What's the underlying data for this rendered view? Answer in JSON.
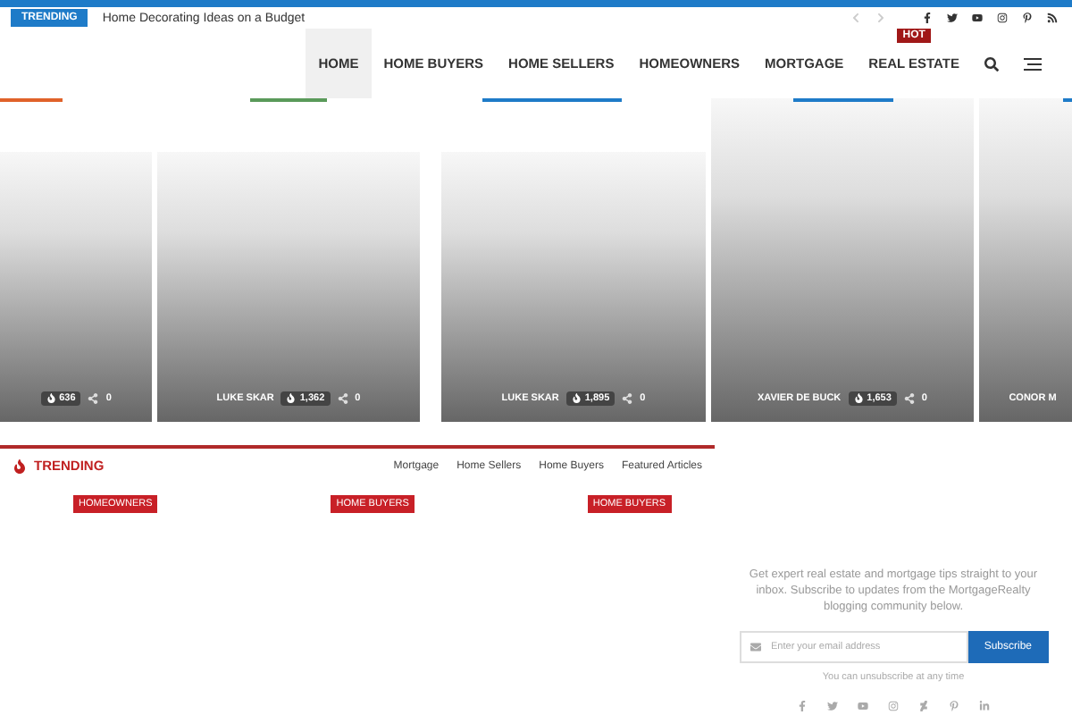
{
  "topbar": {
    "badge": "TRENDING",
    "headline": "Home Decorating Ideas on a Budget"
  },
  "nav": {
    "items": [
      {
        "label": "HOME",
        "selected": true
      },
      {
        "label": "HOME BUYERS",
        "selected": false
      },
      {
        "label": "HOME SELLERS",
        "selected": false
      },
      {
        "label": "HOMEOWNERS",
        "selected": false
      },
      {
        "label": "MORTGAGE",
        "selected": false
      },
      {
        "label": "REAL ESTATE",
        "selected": false,
        "badge": "HOT"
      }
    ]
  },
  "cards": [
    {
      "color": "#e0622a",
      "views": "636",
      "shares": "0"
    },
    {
      "color": "#5a9a5a",
      "author": "LUKE SKAR",
      "views": "1,362",
      "shares": "0"
    },
    {
      "color": "#1e7bc8",
      "author": "LUKE SKAR",
      "views": "1,895",
      "shares": "0"
    },
    {
      "color": "#1e7bc8",
      "author": "XAVIER DE BUCK",
      "views": "1,653",
      "shares": "0"
    },
    {
      "color": "#1e7bc8",
      "author": "CONOR M"
    }
  ],
  "trending": {
    "title": "TRENDING",
    "tabs": [
      "Mortgage",
      "Home Sellers",
      "Home Buyers",
      "Featured Articles"
    ],
    "tags": [
      "HOMEOWNERS",
      "HOME BUYERS",
      "HOME BUYERS"
    ]
  },
  "newsletter": {
    "text": "Get expert real estate and mortgage tips straight to your inbox. Subscribe to updates from the MortgageRealty blogging community below.",
    "placeholder": "Enter your email address",
    "button": "Subscribe",
    "note": "You can unsubscribe at any time"
  }
}
